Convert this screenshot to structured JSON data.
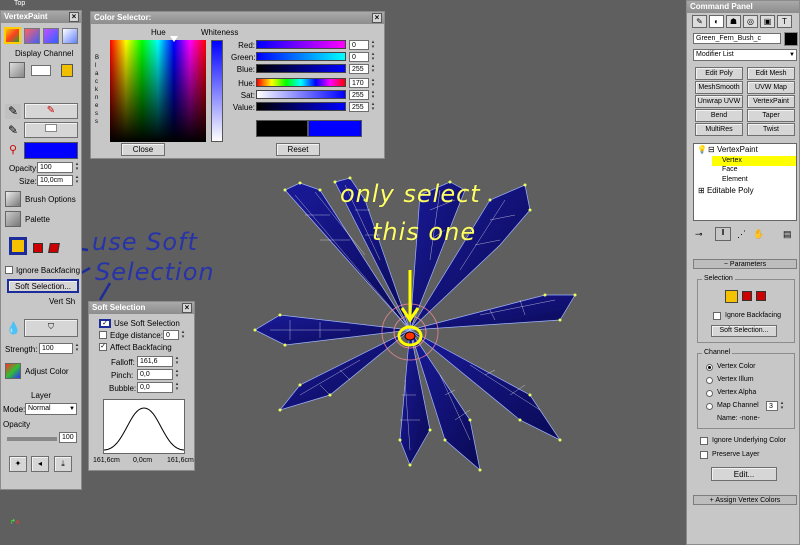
{
  "viewport": {
    "label": "Top"
  },
  "vertex_paint": {
    "title": "VertexPaint",
    "display_channel_label": "Display Channel",
    "display_channel_value": "",
    "opacity_label": "Opacity:",
    "opacity_value": "100",
    "size_label": "Size:",
    "size_value": "10,0cm",
    "brush_options_label": "Brush Options",
    "palette_label": "Palette",
    "ignore_backfacing_label": "Ignore Backfacing",
    "soft_selection_label": "Soft Selection...",
    "vert_sh_label": "Vert Sh",
    "strength_label": "Strength:",
    "strength_value": "100",
    "adjust_color_label": "Adjust Color",
    "layer_label": "Layer",
    "mode_label": "Mode:",
    "mode_value": "Normal",
    "opacity2_label": "Opacity",
    "opacity2_value": "100",
    "paint_color": "#0000ff"
  },
  "color_selector": {
    "title": "Color Selector:",
    "hue_label": "Hue",
    "whiteness_label": "Whiteness",
    "blackness_label": "B l a c k n e s s",
    "fields": [
      {
        "label": "Red:",
        "value": "0"
      },
      {
        "label": "Green:",
        "value": "0"
      },
      {
        "label": "Blue:",
        "value": "255"
      },
      {
        "label": "Hue:",
        "value": "170"
      },
      {
        "label": "Sat:",
        "value": "255"
      },
      {
        "label": "Value:",
        "value": "255"
      }
    ],
    "close_label": "Close",
    "reset_label": "Reset",
    "old_color": "#000000",
    "new_color": "#0000ff"
  },
  "soft_selection_dialog": {
    "title": "Soft Selection",
    "use_soft_selection_label": "Use Soft Selection",
    "edge_distance_label": "Edge distance:",
    "edge_distance_value": "0",
    "affect_backfacing_label": "Affect Backfacing",
    "falloff_label": "Falloff:",
    "falloff_value": "161,6",
    "pinch_label": "Pinch:",
    "pinch_value": "0,0",
    "bubble_label": "Bubble:",
    "bubble_value": "0,0",
    "curve_left": "161,6cm",
    "curve_mid": "0,0cm",
    "curve_right": "161,6cm"
  },
  "annotations": {
    "use_soft_selection": "use Soft",
    "use_soft_selection_2": "Selection",
    "only_select": "only select",
    "this_one": "this one"
  },
  "command_panel": {
    "title": "Command Panel",
    "object_name": "Green_Fern_Bush_c",
    "modifier_list": "Modifier List",
    "modifier_buttons": [
      "Edit Poly",
      "Edit Mesh",
      "MeshSmooth",
      "UVW Map",
      "Unwrap UVW",
      "VertexPaint",
      "Bend",
      "Taper",
      "MultiRes",
      "Twist"
    ],
    "stack": [
      {
        "label": "VertexPaint",
        "level": 0
      },
      {
        "label": "Vertex",
        "level": 1
      },
      {
        "label": "Face",
        "level": 1
      },
      {
        "label": "Element",
        "level": 1
      },
      {
        "label": "Editable Poly",
        "level": 0
      }
    ],
    "parameters_label": "Parameters",
    "selection_label": "Selection",
    "ignore_backfacing_label": "Ignore Backfacing",
    "soft_selection_label": "Soft Selection...",
    "channel_label": "Channel",
    "channel_options": [
      "Vertex Color",
      "Vertex Illum",
      "Vertex Alpha",
      "Map Channel"
    ],
    "map_channel_value": "3",
    "name_label": "Name: -none-",
    "ignore_underlying_label": "Ignore Underlying Color",
    "preserve_layer_label": "Preserve Layer",
    "edit_label": "Edit...",
    "assign_label": "Assign Vertex Colors"
  }
}
